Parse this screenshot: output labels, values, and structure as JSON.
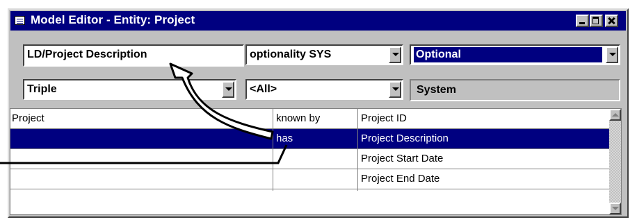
{
  "window": {
    "title": "Model Editor - Entity: Project",
    "icon": "table-icon"
  },
  "form": {
    "name_field": "LD/Project Description",
    "optionality_combo": "optionality SYS",
    "optional_combo": "Optional",
    "triple_combo": "Triple",
    "all_combo": "<All>",
    "system_label": "System"
  },
  "grid": {
    "rows": [
      {
        "c1": "Project",
        "c2": "known by",
        "c3": "Project ID",
        "selected": false
      },
      {
        "c1": "",
        "c2": "has",
        "c3": "Project Description",
        "selected": true
      },
      {
        "c1": "",
        "c2": "",
        "c3": "Project Start Date",
        "selected": false
      },
      {
        "c1": "",
        "c2": "",
        "c3": "Project End Date",
        "selected": false
      }
    ]
  },
  "colors": {
    "title_bar": "#000080",
    "selection": "#000080",
    "face": "#c0c0c0"
  }
}
